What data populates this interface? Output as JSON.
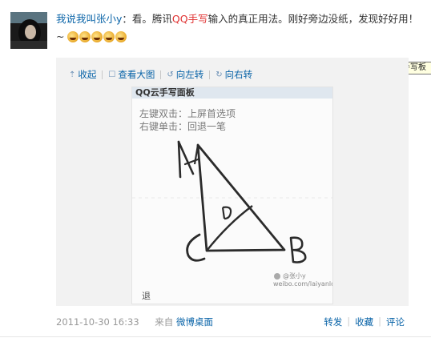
{
  "post": {
    "author": "我说我叫张小y",
    "text_before": "：看。腾讯",
    "highlight": "QQ手写",
    "text_after": "输入的真正用法。刚好旁边没纸，发现好好用！~",
    "emoji_icons": [
      "laugh-emoji-icon",
      "laugh-emoji-icon",
      "grin-emoji-icon",
      "grin-emoji-icon",
      "smile-emoji-icon"
    ]
  },
  "tooltip": "手写板",
  "toolbar": {
    "collapse": "收起",
    "view_large": "查看大图",
    "rotate_left": "向左转",
    "rotate_right": "向右转"
  },
  "photo": {
    "window_title": "QQ云手写面板",
    "hint_line1": "左键双击：上屏首选项",
    "hint_line2": "右键单击：回退一笔",
    "watermark": "@张小y",
    "watermark_url": "weibo.com/laiyanlove",
    "bottom_label": "退"
  },
  "footer": {
    "timestamp": "2011-10-30 16:33",
    "from_label": "来自",
    "source": "微博桌面"
  },
  "actions": {
    "forward": "转发",
    "favorite": "收藏",
    "comment": "评论"
  },
  "colors": {
    "link": "#0a64a8",
    "highlight": "#e03030",
    "muted": "#999999",
    "media_bg": "#f2f2f2"
  }
}
